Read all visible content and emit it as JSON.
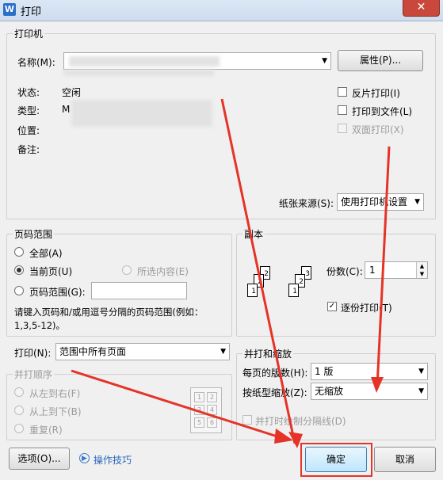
{
  "window": {
    "title": "打印",
    "app_icon": "W"
  },
  "printer": {
    "group_title": "打印机",
    "name_label": "名称(M):",
    "properties_button": "属性(P)...",
    "status_label": "状态:",
    "status_value": "空闲",
    "type_label": "类型:",
    "type_value": "M",
    "location_label": "位置:",
    "comment_label": "备注:",
    "reverse_print": "反片打印(I)",
    "print_to_file": "打印到文件(L)",
    "duplex": "双面打印(X)",
    "paper_source_label": "纸张来源(S):",
    "paper_source_value": "使用打印机设置"
  },
  "page_range": {
    "group_title": "页码范围",
    "all": "全部(A)",
    "current": "当前页(U)",
    "selection": "所选内容(E)",
    "pages": "页码范围(G):",
    "hint_line1": "请键入页码和/或用逗号分隔的页码范围(例如：",
    "hint_line2": "1,3,5-12)。"
  },
  "copies": {
    "group_title": "副本",
    "count_label": "份数(C):",
    "count_value": "1",
    "collate": "逐份打印(T)",
    "stack_a": [
      "1",
      "2",
      "2"
    ],
    "stack_b": [
      "1",
      "2",
      "3"
    ]
  },
  "print_what": {
    "label": "打印(N):",
    "value": "范围中所有页面"
  },
  "order": {
    "group_title": "并打顺序",
    "left_to_right": "从左到右(F)",
    "top_to_bottom": "从上到下(B)",
    "repeat": "重复(R)",
    "grid_numbers": [
      "1",
      "2",
      "3",
      "4",
      "5",
      "6"
    ]
  },
  "zoom": {
    "group_title": "并打和缩放",
    "pages_per_sheet_label": "每页的版数(H):",
    "pages_per_sheet_value": "1 版",
    "scale_label": "按纸型缩放(Z):",
    "scale_value": "无缩放",
    "draw_separator": "并打时绘制分隔线(D)"
  },
  "footer": {
    "options_button": "选项(O)...",
    "tips_link": "操作技巧",
    "ok_button": "确定",
    "cancel_button": "取消"
  },
  "colors": {
    "annotation_red": "#e53328"
  }
}
